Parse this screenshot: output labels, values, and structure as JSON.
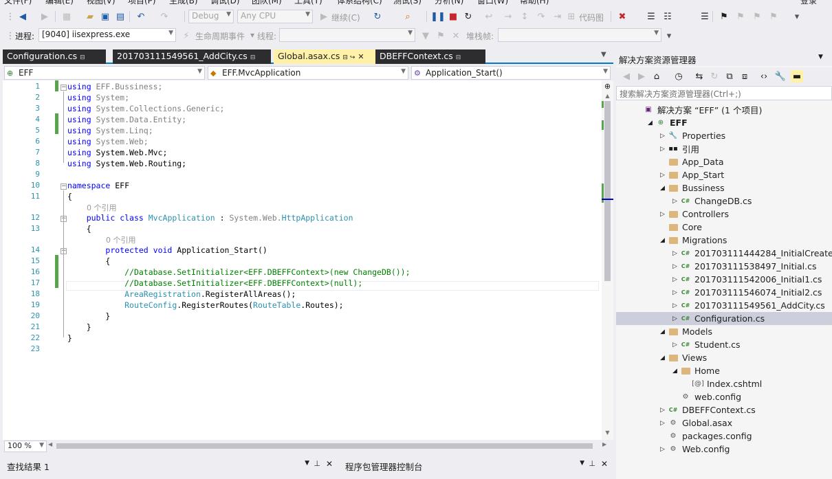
{
  "menu": {
    "items": [
      "文件(F)",
      "编辑(E)",
      "视图(V)",
      "项目(P)",
      "生成(B)",
      "调试(D)",
      "团队(M)",
      "工具(T)",
      "体系结构(C)",
      "测试(S)",
      "分析(N)",
      "窗口(W)",
      "帮助(H)"
    ],
    "login": "登录"
  },
  "toolbar": {
    "config": "Debug",
    "platform": "Any CPU",
    "continue_label": "继续(C)",
    "codemap_label": "代码图"
  },
  "toolbar2": {
    "process_label": "进程:",
    "process_value": "[9040] iisexpress.exe",
    "lifecycle_label": "生命周期事件",
    "thread_label": "线程:",
    "stackframe_label": "堆栈帧:"
  },
  "tabs": [
    {
      "label": "Configuration.cs"
    },
    {
      "label": "201703111549561_AddCity.cs"
    },
    {
      "label": "Global.asax.cs"
    },
    {
      "label": "DBEFFContext.cs"
    }
  ],
  "navbar": {
    "project": "EFF",
    "type": "EFF.MvcApplication",
    "member": "Application_Start()"
  },
  "editor": {
    "line_numbers": [
      "1",
      "2",
      "3",
      "4",
      "5",
      "6",
      "7",
      "8",
      "9",
      "10",
      "11",
      "12",
      "13",
      "14",
      "15",
      "16",
      "17",
      "18",
      "19",
      "20",
      "21",
      "22",
      "23"
    ],
    "ref_hint": "0 个引用",
    "zoom": "100 %"
  },
  "bottom_panels": {
    "find_results": "查找结果 1",
    "package_console": "程序包管理器控制台"
  },
  "solution_explorer": {
    "title": "解决方案资源管理器",
    "search_placeholder": "搜索解决方案资源管理器(Ctrl+;)",
    "items": [
      {
        "label": "解决方案 “EFF” (1 个项目)",
        "icon": "solution-icon"
      },
      {
        "label": "EFF",
        "icon": "web-project-icon"
      },
      {
        "label": "Properties",
        "icon": "wrench-icon"
      },
      {
        "label": "引用",
        "icon": "references-icon"
      },
      {
        "label": "App_Data",
        "icon": "folder-icon"
      },
      {
        "label": "App_Start",
        "icon": "folder-icon"
      },
      {
        "label": "Bussiness",
        "icon": "folder-icon"
      },
      {
        "label": "ChangeDB.cs",
        "icon": "csharp-file-icon"
      },
      {
        "label": "Controllers",
        "icon": "folder-icon"
      },
      {
        "label": "Core",
        "icon": "folder-icon"
      },
      {
        "label": "Migrations",
        "icon": "folder-icon"
      },
      {
        "label": "201703111444284_InitialCreate.cs",
        "icon": "csharp-file-icon"
      },
      {
        "label": "201703111538497_Initial.cs",
        "icon": "csharp-file-icon"
      },
      {
        "label": "201703111542006_Initial1.cs",
        "icon": "csharp-file-icon"
      },
      {
        "label": "201703111546074_Initial2.cs",
        "icon": "csharp-file-icon"
      },
      {
        "label": "201703111549561_AddCity.cs",
        "icon": "csharp-file-icon"
      },
      {
        "label": "Configuration.cs",
        "icon": "csharp-file-icon"
      },
      {
        "label": "Models",
        "icon": "folder-icon"
      },
      {
        "label": "Student.cs",
        "icon": "csharp-file-icon"
      },
      {
        "label": "Views",
        "icon": "folder-icon"
      },
      {
        "label": "Home",
        "icon": "folder-icon"
      },
      {
        "label": "Index.cshtml",
        "icon": "razor-file-icon"
      },
      {
        "label": "web.config",
        "icon": "config-file-icon"
      },
      {
        "label": "DBEFFContext.cs",
        "icon": "csharp-file-icon"
      },
      {
        "label": "Global.asax",
        "icon": "global-asax-icon"
      },
      {
        "label": "packages.config",
        "icon": "config-file-icon"
      },
      {
        "label": "Web.config",
        "icon": "config-file-icon"
      }
    ]
  },
  "colors": {
    "accent": "#007acc",
    "selected_tab": "#fff1a8",
    "keyword": "#0000ff",
    "type": "#2b91af",
    "comment": "#008000",
    "change_bar": "#57a64a"
  }
}
